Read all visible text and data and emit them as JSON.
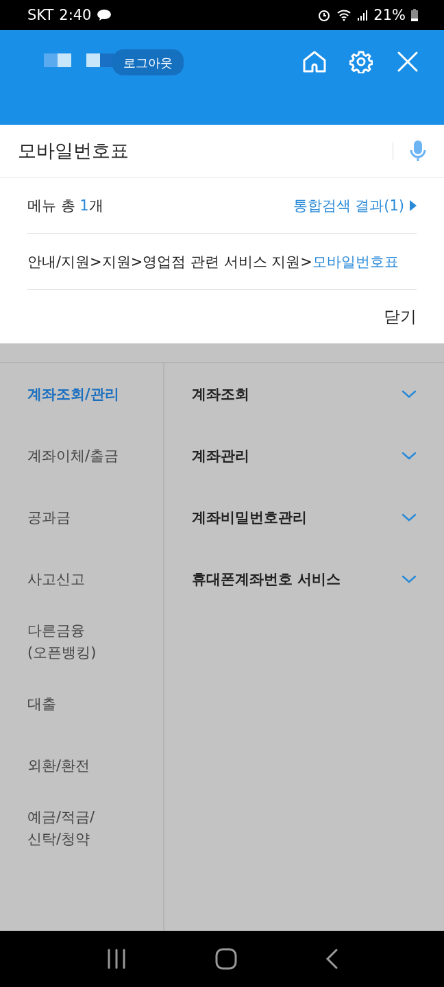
{
  "status_bar": {
    "carrier": "SKT",
    "time": "2:40",
    "battery": "21%"
  },
  "header": {
    "logout": "로그아웃"
  },
  "search": {
    "value": "모바일번호표"
  },
  "results": {
    "count_prefix": "메뉴 총 ",
    "count": "1",
    "count_suffix": "개",
    "all_results": "통합검색 결과(1)",
    "path": "안내/지원>지원>영업점 관련 서비스 지원>",
    "current": "모바일번호표",
    "close": "닫기"
  },
  "categories": [
    {
      "label": "계좌조회/관리",
      "selected": true
    },
    {
      "label": "계좌이체/출금",
      "selected": false
    },
    {
      "label": "공과금",
      "selected": false
    },
    {
      "label": "사고신고",
      "selected": false
    },
    {
      "label": "다른금융\n(오픈뱅킹)",
      "selected": false
    },
    {
      "label": "대출",
      "selected": false
    },
    {
      "label": "외환/환전",
      "selected": false
    },
    {
      "label": "예금/적금/\n신탁/청약",
      "selected": false
    }
  ],
  "submenu": [
    {
      "label": "계좌조회"
    },
    {
      "label": "계좌관리"
    },
    {
      "label": "계좌비밀번호관리"
    },
    {
      "label": "휴대폰계좌번호 서비스"
    }
  ]
}
